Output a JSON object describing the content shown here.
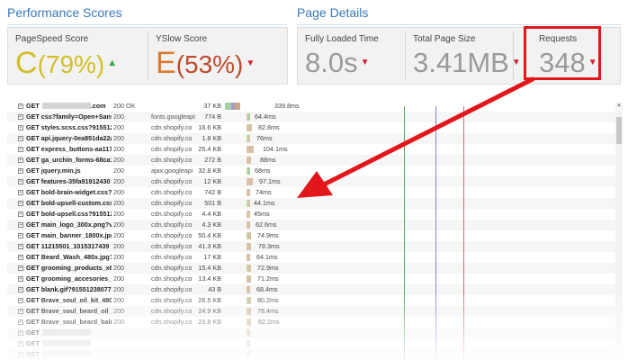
{
  "performance_scores": {
    "title": "Performance Scores",
    "pagespeed": {
      "label": "PageSpeed Score",
      "grade": "C",
      "percent": "(79%)",
      "trend_icon": "arrow-up-icon"
    },
    "yslow": {
      "label": "YSlow Score",
      "grade": "E",
      "percent": "(53%)",
      "trend_icon": "arrow-down-icon"
    }
  },
  "page_details": {
    "title": "Page Details",
    "fully_loaded": {
      "label": "Fully Loaded Time",
      "value": "8.0s"
    },
    "total_size": {
      "label": "Total Page Size",
      "value": "3.41MB"
    },
    "requests": {
      "label": "Requests",
      "value": "348"
    }
  },
  "colors": {
    "accent": "#3a78b8",
    "grade_c": "#d2bf28",
    "grade_e": "#dd7a30",
    "arrow_down": "#d2222e",
    "arrow_up": "#3ba34a",
    "annotation_red": "#e3161b"
  },
  "waterfall": {
    "requests": [
      {
        "url": "GET",
        "url_tail": ".com",
        "status": "200 OK",
        "domain": "",
        "size": "37 KB",
        "time": "339.8ms"
      },
      {
        "url": "GET css?family=Open+Sans:",
        "status": "200",
        "domain": "fonts.googleapi",
        "size": "774 B",
        "time": "64.4ms"
      },
      {
        "url": "GET styles.scss.css?915512",
        "status": "200",
        "domain": "cdn.shopify.co",
        "size": "16.6 KB",
        "time": "82.8ms"
      },
      {
        "url": "GET api.jquery-0ea851da22a",
        "status": "200",
        "domain": "cdn.shopify.co",
        "size": "1.8 KB",
        "time": "76ms"
      },
      {
        "url": "GET express_buttons-aa117",
        "status": "200",
        "domain": "cdn.shopify.co",
        "size": "25.4 KB",
        "time": "104.1ms"
      },
      {
        "url": "GET ga_urchin_forms-68ca1",
        "status": "200",
        "domain": "cdn.shopify.co",
        "size": "272 B",
        "time": "88ms"
      },
      {
        "url": "GET jquery.min.js",
        "status": "200",
        "domain": "ajax.googleapi",
        "size": "32.8 KB",
        "time": "68ms"
      },
      {
        "url": "GET features-35fa91912430",
        "status": "200",
        "domain": "cdn.shopify.co",
        "size": "12 KB",
        "time": "97.1ms"
      },
      {
        "url": "GET bold-brain-widget.css?",
        "status": "200",
        "domain": "cdn.shopify.co",
        "size": "742 B",
        "time": "74ms"
      },
      {
        "url": "GET bold-upsell-custom.css?",
        "status": "200",
        "domain": "cdn.shopify.co",
        "size": "501 B",
        "time": "44.1ms"
      },
      {
        "url": "GET bold-upsell.css?915512",
        "status": "200",
        "domain": "cdn.shopify.co",
        "size": "4.4 KB",
        "time": "45ms"
      },
      {
        "url": "GET main_logo_300x.png?v=",
        "status": "200",
        "domain": "cdn.shopify.co",
        "size": "4.3 KB",
        "time": "62.6ms"
      },
      {
        "url": "GET main_banner_1800x.jpg",
        "status": "200",
        "domain": "cdn.shopify.co",
        "size": "50.4 KB",
        "time": "74.9ms"
      },
      {
        "url": "GET 11215501_1015317439",
        "status": "200",
        "domain": "cdn.shopify.co",
        "size": "41.3 KB",
        "time": "78.3ms"
      },
      {
        "url": "GET Beard_Wash_480x.jpg?v",
        "status": "200",
        "domain": "cdn.shopify.co",
        "size": "17 KB",
        "time": "64.1ms"
      },
      {
        "url": "GET grooming_products_x60",
        "status": "200",
        "domain": "cdn.shopify.co",
        "size": "15.4 KB",
        "time": "72.9ms"
      },
      {
        "url": "GET grooming_accesories_x6",
        "status": "200",
        "domain": "cdn.shopify.co",
        "size": "13.4 KB",
        "time": "71.2ms"
      },
      {
        "url": "GET blank.gif?915512380770",
        "status": "200",
        "domain": "cdn.shopify.co",
        "size": "43 B",
        "time": "68.4ms"
      },
      {
        "url": "GET Brave_soul_oil_kit_480x.",
        "status": "200",
        "domain": "cdn.shopify.co",
        "size": "26.5 KB",
        "time": "80.2ms"
      },
      {
        "url": "GET Brave_soul_beard_oil_48",
        "status": "200",
        "domain": "cdn.shopify.co",
        "size": "24.9 KB",
        "time": "78.4ms"
      },
      {
        "url": "GET Brave_soul_beard_balm_",
        "status": "200",
        "domain": "cdn.shopify.co",
        "size": "23.8 KB",
        "time": "82.2ms"
      },
      {
        "url": "GET",
        "status": "",
        "domain": "",
        "size": "",
        "time": ""
      },
      {
        "url": "GET",
        "status": "",
        "domain": "",
        "size": "",
        "time": ""
      },
      {
        "url": "GET",
        "status": "",
        "domain": "",
        "size": "",
        "time": ""
      }
    ]
  }
}
